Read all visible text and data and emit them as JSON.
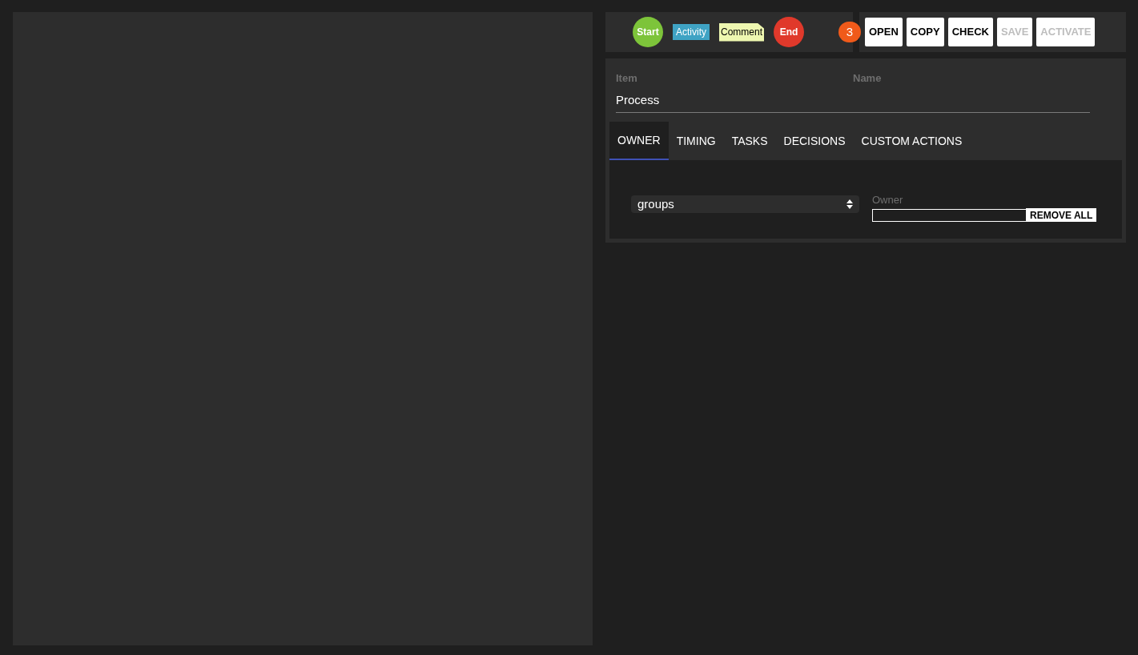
{
  "palette": {
    "nodes": [
      {
        "kind": "start",
        "label": "Start",
        "color": "#7dc43a"
      },
      {
        "kind": "activity",
        "label": "Activity",
        "color": "#3fa3c4"
      },
      {
        "kind": "comment",
        "label": "Comment",
        "color": "#eef7b0"
      },
      {
        "kind": "end",
        "label": "End",
        "color": "#e0392b"
      }
    ]
  },
  "badge": "3",
  "toolbar": [
    {
      "label": "OPEN",
      "disabled": false
    },
    {
      "label": "COPY",
      "disabled": false
    },
    {
      "label": "CHECK",
      "disabled": false
    },
    {
      "label": "SAVE",
      "disabled": true
    },
    {
      "label": "ACTIVATE",
      "disabled": true
    }
  ],
  "form": {
    "item_label": "Item",
    "name_label": "Name",
    "value": "Process"
  },
  "tabs": [
    {
      "label": "OWNER",
      "selected": true
    },
    {
      "label": "TIMING",
      "selected": false
    },
    {
      "label": "TASKS",
      "selected": false
    },
    {
      "label": "DECISIONS",
      "selected": false
    },
    {
      "label": "CUSTOM ACTIONS",
      "selected": false
    }
  ],
  "owner": {
    "select_value": "groups",
    "owner_placeholder": "Owner",
    "remove_button": "REMOVE ALL"
  }
}
